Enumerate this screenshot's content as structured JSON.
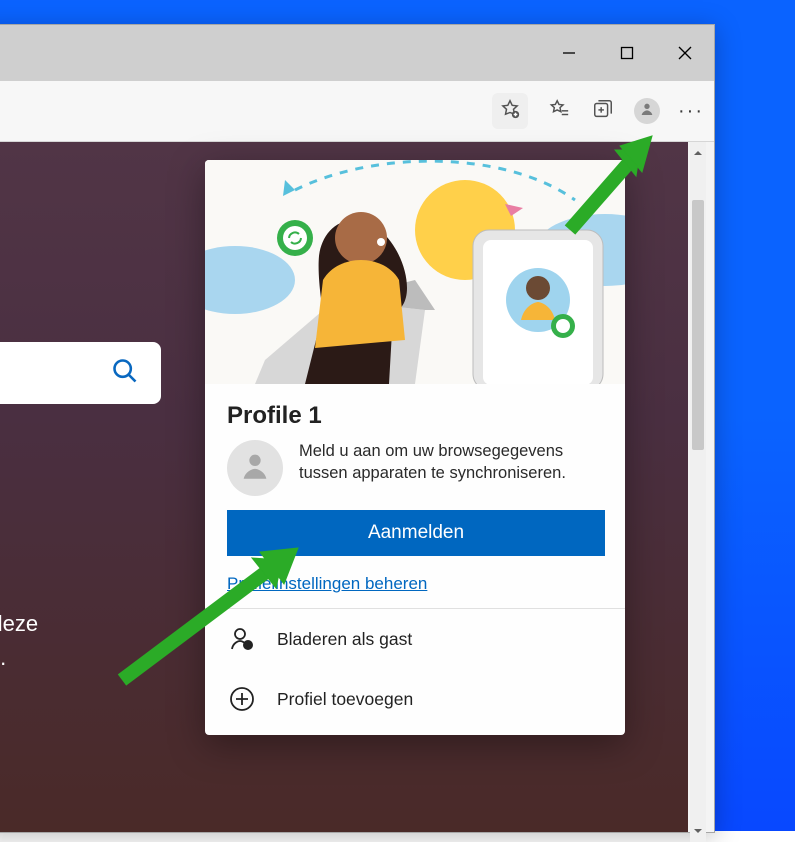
{
  "window_controls": {
    "minimize": "minimize",
    "maximize": "maximize",
    "close": "close"
  },
  "toolbar": {
    "add_favorite": "add-favorite-star-icon",
    "favorites": "favorites-list-icon",
    "collections": "collections-icon",
    "profile": "profile-avatar-button",
    "more": "more-menu"
  },
  "newtab": {
    "line1": "lat deze",
    "line2": "was."
  },
  "profile_flyout": {
    "title": "Profile 1",
    "message": "Meld u aan om uw browsegegevens tussen apparaten te synchroniseren.",
    "signin_button": "Aanmelden",
    "manage_link": "Profielinstellingen beheren",
    "browse_guest": "Bladeren als gast",
    "add_profile": "Profiel toevoegen"
  }
}
